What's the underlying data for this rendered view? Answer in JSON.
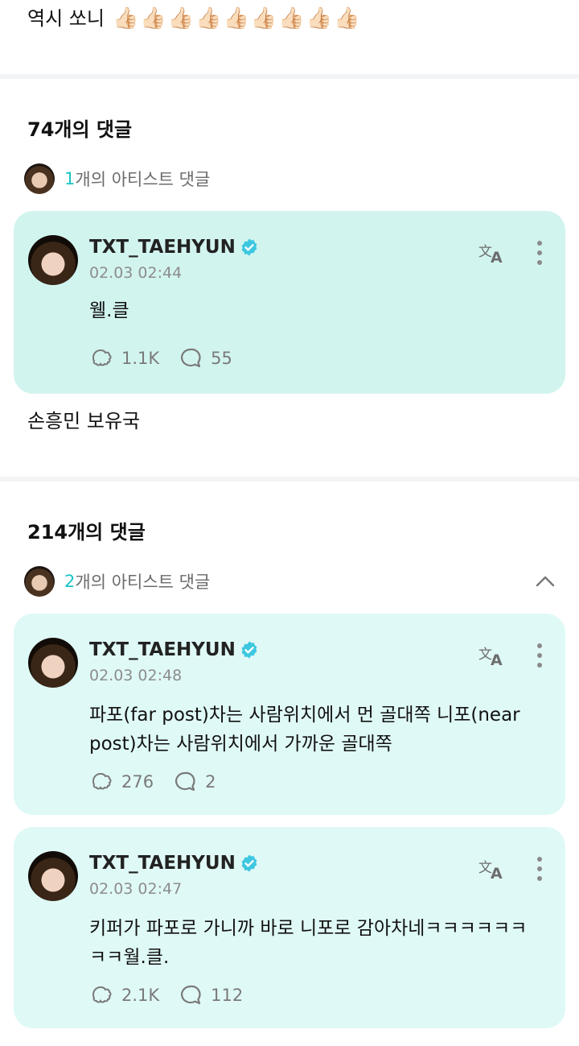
{
  "top_post": {
    "text": "역시 쏘니",
    "emoji": "👍🏻",
    "emoji_count": 9
  },
  "section1": {
    "title": "74개의 댓글",
    "artist_count": "1",
    "artist_label": "개의 아티스트 댓글",
    "comments": [
      {
        "name": "TXT_TAEHYUN",
        "time": "02.03 02:44",
        "body": "웰.클",
        "likes": "1.1K",
        "replies": "55"
      }
    ],
    "post_text": "손흥민 보유국"
  },
  "section2": {
    "title": "214개의 댓글",
    "artist_count": "2",
    "artist_label": "개의 아티스트 댓글",
    "comments": [
      {
        "name": "TXT_TAEHYUN",
        "time": "02.03 02:48",
        "body": "파포(far post)차는 사람위치에서 먼 골대쪽 니포(near post)차는 사람위치에서 가까운 골대쪽",
        "likes": "276",
        "replies": "2"
      },
      {
        "name": "TXT_TAEHYUN",
        "time": "02.03 02:47",
        "body": "키퍼가 파포로 가니까 바로 니포로 감아차네ㅋㅋㅋㅋㅋㅋㅋㅋ월.클.",
        "likes": "2.1K",
        "replies": "112"
      }
    ]
  },
  "icons": {
    "verified": "verified-badge-icon",
    "translate": "translate-icon",
    "more": "more-vertical-icon",
    "like": "like-icon",
    "reply": "reply-bubble-icon",
    "collapse": "chevron-up-icon"
  },
  "colors": {
    "accent": "#19c5c5",
    "card_bg_1": "#d2f4ef",
    "card_bg_2": "#dff9f6",
    "verified": "#3ec7e0"
  }
}
